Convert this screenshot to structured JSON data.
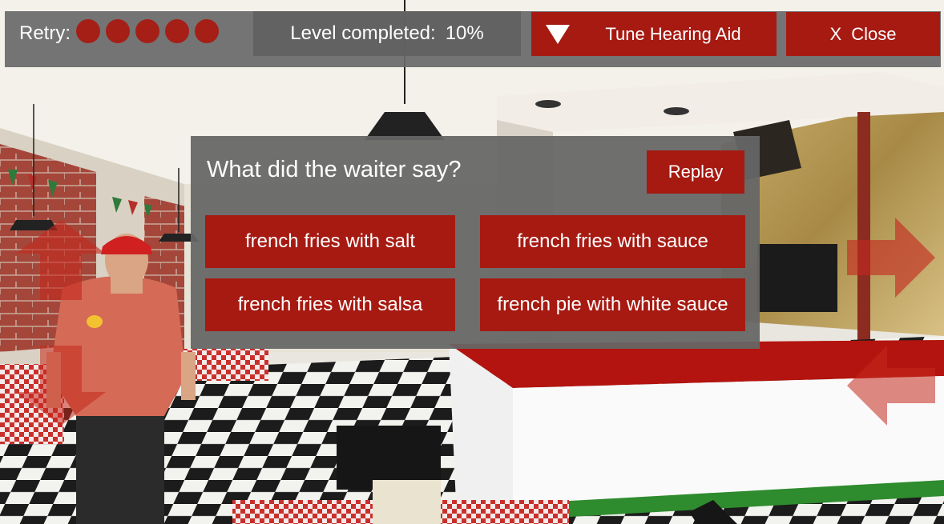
{
  "hud": {
    "retry_label": "Retry:",
    "retries_remaining": 5,
    "level_label": "Level completed:",
    "level_value": "10%",
    "tune_label": "Tune Hearing Aid",
    "close_x": "X",
    "close_label": "Close"
  },
  "dialog": {
    "question": "What did the waiter say?",
    "replay_label": "Replay",
    "answers": [
      "french fries with salt",
      "french fries with sauce",
      "french fries with salsa",
      "french pie with white sauce"
    ]
  },
  "colors": {
    "accent_red": "#a61a12",
    "panel_gray": "#666666"
  },
  "icons": [
    "dropdown-triangle-icon",
    "arrow-up-icon",
    "arrow-down-icon",
    "arrow-right-icon",
    "arrow-left-icon"
  ]
}
